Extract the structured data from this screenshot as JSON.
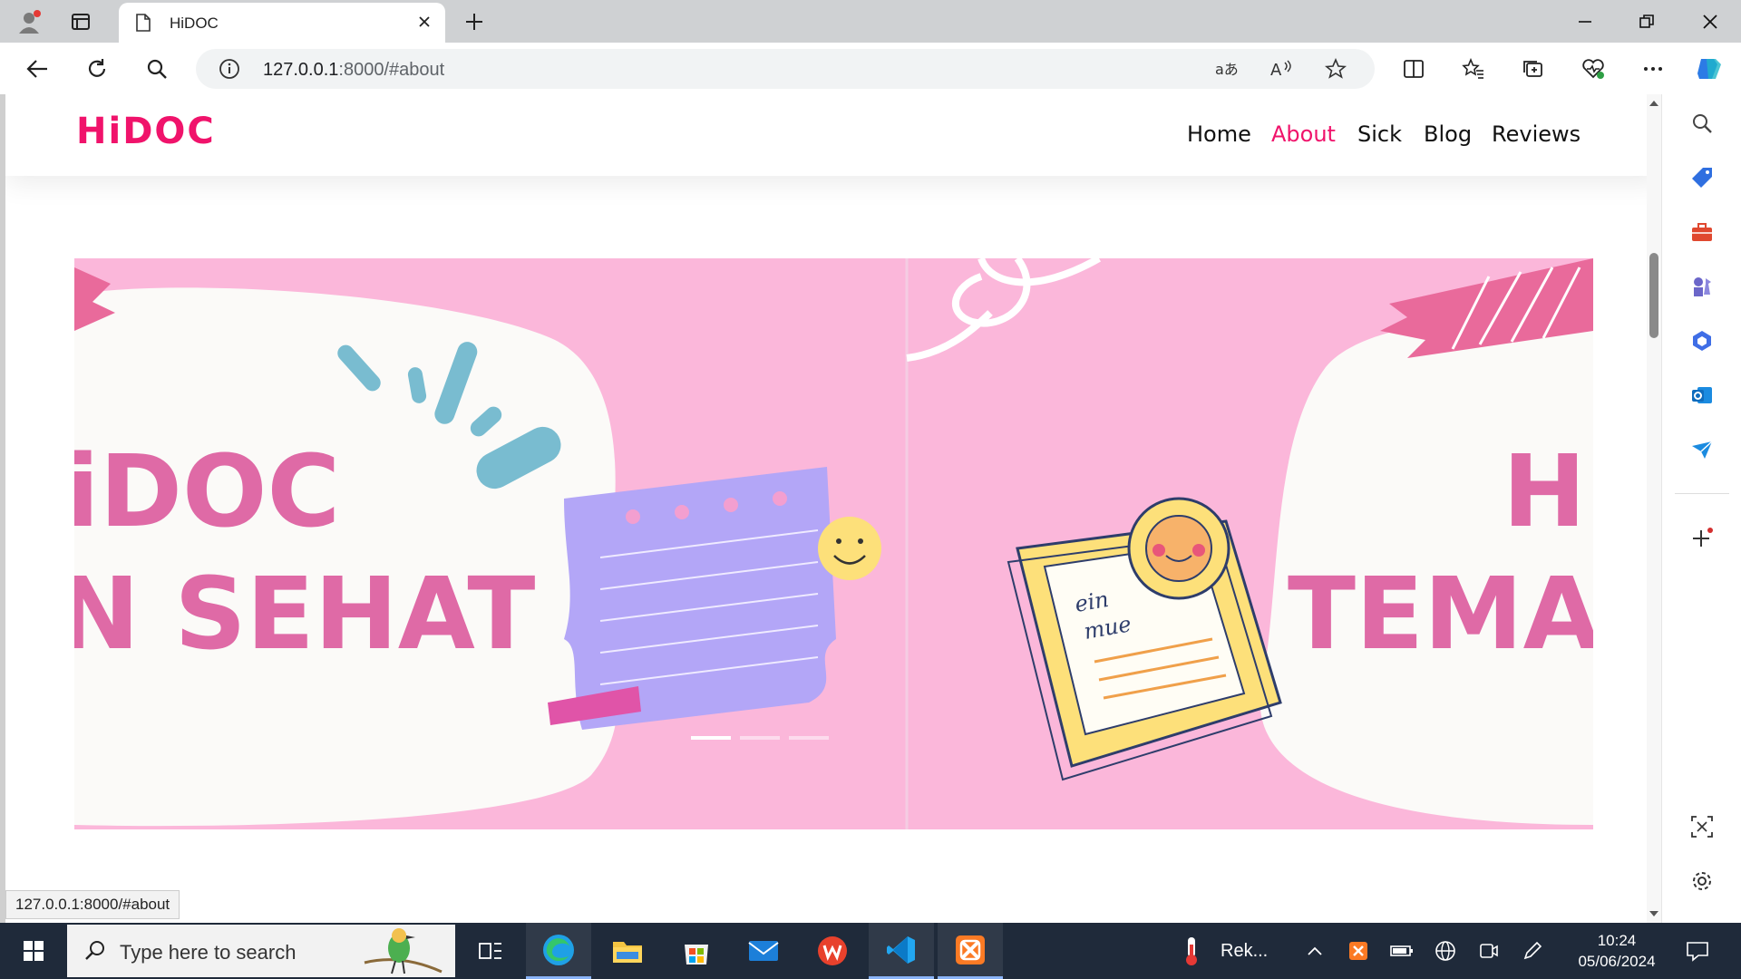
{
  "browser": {
    "tab": {
      "title": "HiDOC"
    },
    "address": {
      "host": "127.0.0.1",
      "rest": ":8000/#about"
    },
    "status_url": "127.0.0.1:8000/#about"
  },
  "site": {
    "logo": "HiDOC",
    "nav": [
      "Home",
      "About",
      "Sick",
      "Blog",
      "Reviews"
    ],
    "active_nav": "About",
    "hero": {
      "left_lines": [
        "iDOC",
        "N SEHAT"
      ],
      "right_lines": [
        "Hi",
        "TEMA"
      ],
      "note_text": [
        "ein",
        "mue"
      ],
      "indicator_count": 3,
      "active_indicator": 0
    }
  },
  "taskbar": {
    "search_placeholder": "Type here to search",
    "weather_label": "Rek...",
    "time": "10:24",
    "date": "05/06/2024"
  },
  "colors": {
    "brand": "#f0136b",
    "hero_pink": "#fbb7da",
    "hero_text": "#df6aa6"
  }
}
